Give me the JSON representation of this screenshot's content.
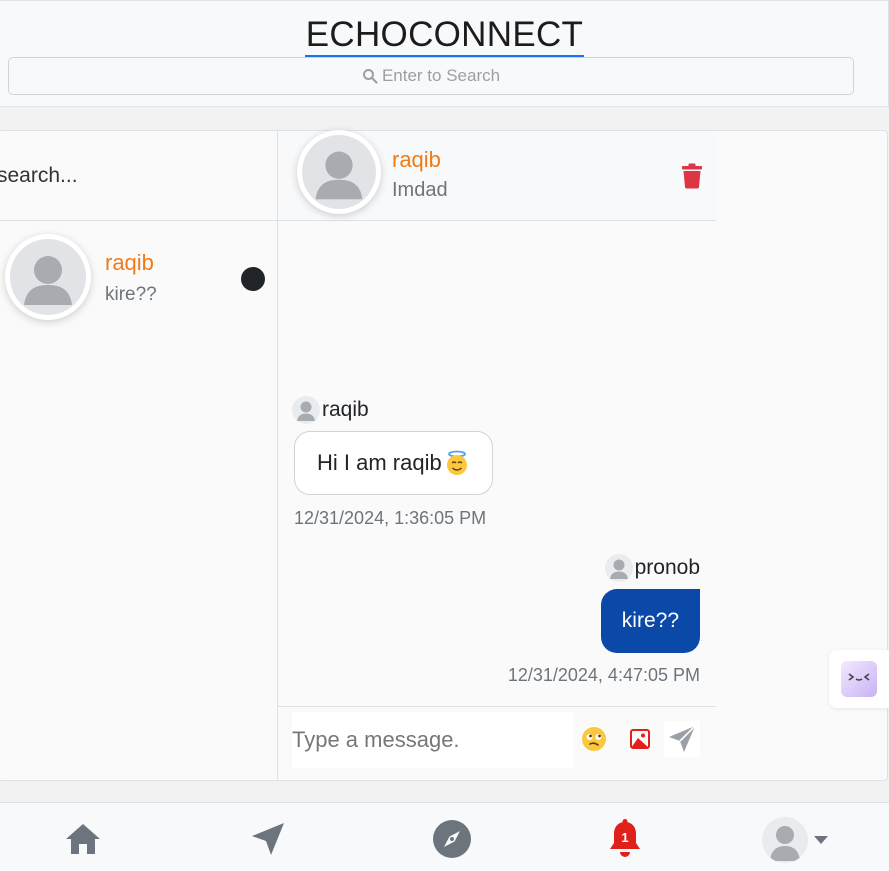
{
  "header": {
    "brand": "ECHOCONNECT",
    "search_placeholder": "Enter to Search"
  },
  "sidebar": {
    "search_placeholder": "search...",
    "conversations": [
      {
        "name": "raqib",
        "last_message": "kire??",
        "unread": true
      }
    ]
  },
  "chat": {
    "contact_name": "raqib",
    "contact_subtitle": "Imdad",
    "messages": [
      {
        "sender": "raqib",
        "text": "Hi I am raqib",
        "emoji": "smiling-face-with-halo",
        "time": "12/31/2024, 1:36:05 PM",
        "direction": "incoming"
      },
      {
        "sender": "pronob",
        "text": "kire??",
        "time": "12/31/2024, 4:47:05 PM",
        "direction": "outgoing"
      }
    ],
    "composer_placeholder": "Type a message."
  },
  "bottom_nav": {
    "items": [
      "home-icon",
      "send-icon",
      "compass-icon",
      "bell-icon",
      "profile-avatar"
    ],
    "notification_count": "1"
  },
  "colors": {
    "contact_name": "#f07b17",
    "outgoing_bubble": "#0b49a8",
    "trash": "#dc3545",
    "notification": "#e0201a",
    "brand_underline": "#1a73e8"
  }
}
